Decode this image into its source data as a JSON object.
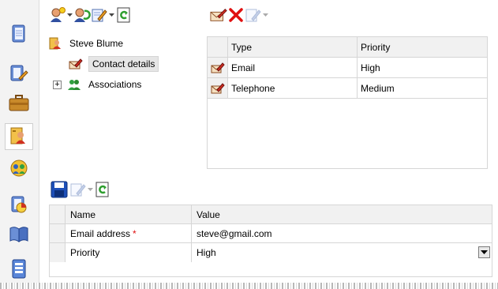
{
  "left_bar": {
    "icons": [
      "notebook-icon",
      "card-edit-icon",
      "briefcase-icon",
      "contact-card-icon",
      "users-group-icon",
      "report-chart-icon",
      "book-icon",
      "document-list-icon"
    ],
    "active_index": 3
  },
  "tree_toolbar": {
    "buttons": [
      "add-contact-icon",
      "contact-refresh-icon",
      "edit-icon",
      "refresh-icon"
    ]
  },
  "tree": {
    "items": [
      {
        "label": "Steve Blume",
        "icon": "contact-card-icon"
      },
      {
        "label": "Contact details",
        "icon": "edit-card-icon",
        "selected": true
      },
      {
        "label": "Associations",
        "icon": "users-group-icon",
        "expander": "+"
      }
    ]
  },
  "grid_toolbar": {
    "buttons": [
      "edit-card-icon",
      "delete-icon",
      "edit-icon"
    ]
  },
  "contact_grid": {
    "columns": [
      "Type",
      "Priority"
    ],
    "rows": [
      {
        "type": "Email",
        "priority": "High"
      },
      {
        "type": "Telephone",
        "priority": "Medium"
      }
    ]
  },
  "property_toolbar": {
    "buttons": [
      "save-icon",
      "edit-icon",
      "refresh-icon"
    ]
  },
  "properties": {
    "columns": [
      "Name",
      "Value"
    ],
    "rows": [
      {
        "name": "Email address",
        "required": "*",
        "value": "steve@gmail.com"
      },
      {
        "name": "Priority",
        "value": "High"
      }
    ]
  },
  "colors": {
    "accent_red": "#e01010",
    "refresh_green": "#2e9e2e",
    "save_blue": "#1d4fb8",
    "grid_line": "#d6d6d6",
    "header_bg": "#f1f1f1"
  }
}
